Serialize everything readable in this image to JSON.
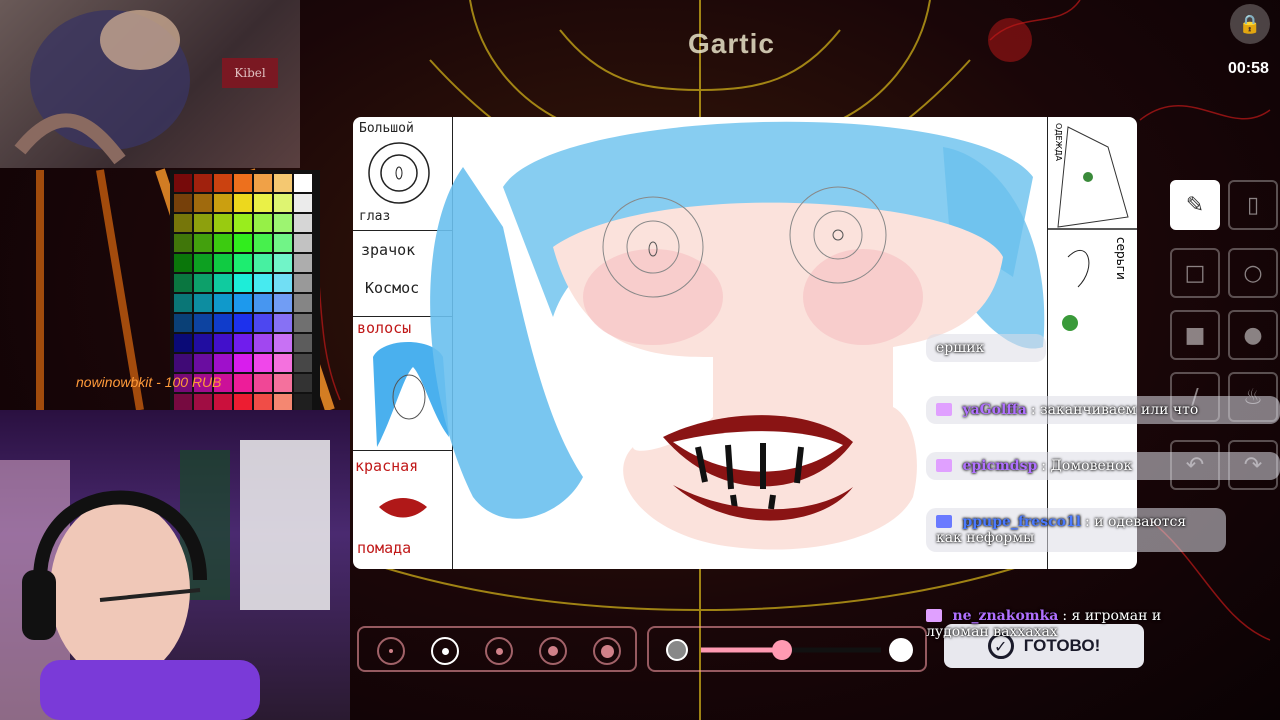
{
  "stream": {
    "donation_text": "nowinowbkit - 100 RUB",
    "overlay_tag": "Kibel"
  },
  "game": {
    "logo": "Gartic",
    "timer": "00:58",
    "reference_labels": {
      "eye": [
        "Большой",
        "глаз"
      ],
      "pupil": [
        "зрачок",
        "Космос"
      ],
      "hair": "волосы",
      "lips": [
        "красная",
        "помада"
      ],
      "right_top": "ОДЕЖДА",
      "right_mid": "серьги"
    },
    "tools": [
      {
        "name": "pencil",
        "icon": "pencil-icon",
        "active": true
      },
      {
        "name": "eraser",
        "icon": "eraser-icon",
        "active": false
      },
      {
        "name": "rect-outline",
        "icon": "square-icon",
        "active": false
      },
      {
        "name": "ellipse-outline",
        "icon": "circle-icon",
        "active": false
      },
      {
        "name": "rect-fill",
        "icon": "square-fill-icon",
        "active": false
      },
      {
        "name": "ellipse-fill",
        "icon": "circle-fill-icon",
        "active": false
      },
      {
        "name": "line",
        "icon": "line-icon",
        "active": false
      },
      {
        "name": "fill",
        "icon": "bucket-icon",
        "active": false
      },
      {
        "name": "undo",
        "icon": "undo-icon",
        "active": false
      },
      {
        "name": "redo",
        "icon": "redo-icon",
        "active": false
      }
    ],
    "brush_sizes": 5,
    "active_brush_size_index": 1,
    "opacity_level": 0.45,
    "done_label": "ГОТОВО!",
    "colors": {
      "hair": "#5ab8ec",
      "skin": "#fbe2dc",
      "blush": "#f4b0b0",
      "lips": "#8a1414",
      "selected": "#ff9ab2"
    }
  },
  "chat": [
    {
      "user": "",
      "text": "ершик",
      "badge": false
    },
    {
      "user": "yaGolffa",
      "text": "заканчиваем или что",
      "badge": true,
      "user_color": "#b070ff"
    },
    {
      "user": "epicmdsp",
      "text": "Домовенок",
      "badge": true,
      "user_color": "#b070ff"
    },
    {
      "user": "ppupe_fresco1l",
      "text": "и одеваются как неформы",
      "badge": true,
      "user_color": "#4a7aff"
    },
    {
      "user": "ne_znakomka",
      "text": "я игроман и лудоман ваххахах",
      "badge": true,
      "user_color": "#b070ff"
    }
  ]
}
